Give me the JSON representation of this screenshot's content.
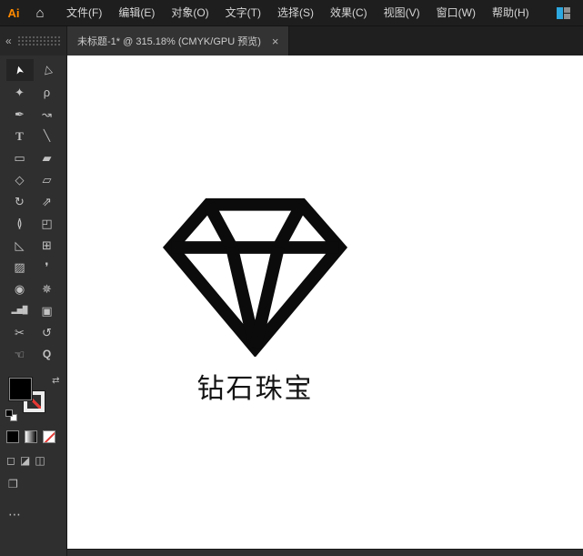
{
  "app": {
    "logo": "Ai",
    "home_glyph": "⌂"
  },
  "menubar": {
    "items": [
      "文件(F)",
      "编辑(E)",
      "对象(O)",
      "文字(T)",
      "选择(S)",
      "效果(C)",
      "视图(V)",
      "窗口(W)",
      "帮助(H)"
    ]
  },
  "tab": {
    "title": "未标题-1* @ 315.18% (CMYK/GPU 预览)",
    "close_glyph": "×"
  },
  "tools_panel": {
    "collapse_glyph": "«",
    "tools": [
      {
        "name": "selection",
        "glyph": "➤",
        "active": true
      },
      {
        "name": "direct-selection",
        "glyph": "▷"
      },
      {
        "name": "magic-wand",
        "glyph": "✦"
      },
      {
        "name": "lasso",
        "glyph": "ρ"
      },
      {
        "name": "pen",
        "glyph": "✒"
      },
      {
        "name": "curvature",
        "glyph": "↝"
      },
      {
        "name": "type",
        "glyph": "T"
      },
      {
        "name": "line-segment",
        "glyph": "╲"
      },
      {
        "name": "rectangle",
        "glyph": "▭"
      },
      {
        "name": "paintbrush",
        "glyph": "▰"
      },
      {
        "name": "shaper",
        "glyph": "◇"
      },
      {
        "name": "eraser",
        "glyph": "▱"
      },
      {
        "name": "rotate",
        "glyph": "↻"
      },
      {
        "name": "scale",
        "glyph": "⇗"
      },
      {
        "name": "width",
        "glyph": "≬"
      },
      {
        "name": "free-transform",
        "glyph": "◰"
      },
      {
        "name": "perspective-grid",
        "glyph": "◺"
      },
      {
        "name": "mesh",
        "glyph": "⊞"
      },
      {
        "name": "gradient",
        "glyph": "▨"
      },
      {
        "name": "eyedropper",
        "glyph": "❜"
      },
      {
        "name": "blend",
        "glyph": "◉"
      },
      {
        "name": "symbol-sprayer",
        "glyph": "✵"
      },
      {
        "name": "column-graph",
        "glyph": "▂▅█"
      },
      {
        "name": "artboard",
        "glyph": "▣"
      },
      {
        "name": "slice",
        "glyph": "✂"
      },
      {
        "name": "rotate-view",
        "glyph": "↺"
      },
      {
        "name": "hand",
        "glyph": "☜"
      },
      {
        "name": "zoom",
        "glyph": "Q"
      }
    ],
    "fill_stroke": {
      "fill_color": "#000000",
      "stroke": "none",
      "swap_glyph": "⇄"
    },
    "swatch_buttons": [
      "color",
      "gradient",
      "none"
    ],
    "drawing_modes": [
      {
        "name": "draw-normal",
        "glyph": "◻"
      },
      {
        "name": "draw-behind",
        "glyph": "◪"
      },
      {
        "name": "draw-inside",
        "glyph": "◫"
      }
    ],
    "screen_mode_glyph": "❐",
    "edit_toolbar_glyph": "⋯"
  },
  "canvas": {
    "logo_label": "钻石珠宝"
  },
  "colors": {
    "accent_orange": "#ff8a00",
    "workspace_icon_blue": "#2da8e0",
    "none_red": "#e53935",
    "artwork_black": "#0b0b0b",
    "canvas_white": "#ffffff"
  }
}
